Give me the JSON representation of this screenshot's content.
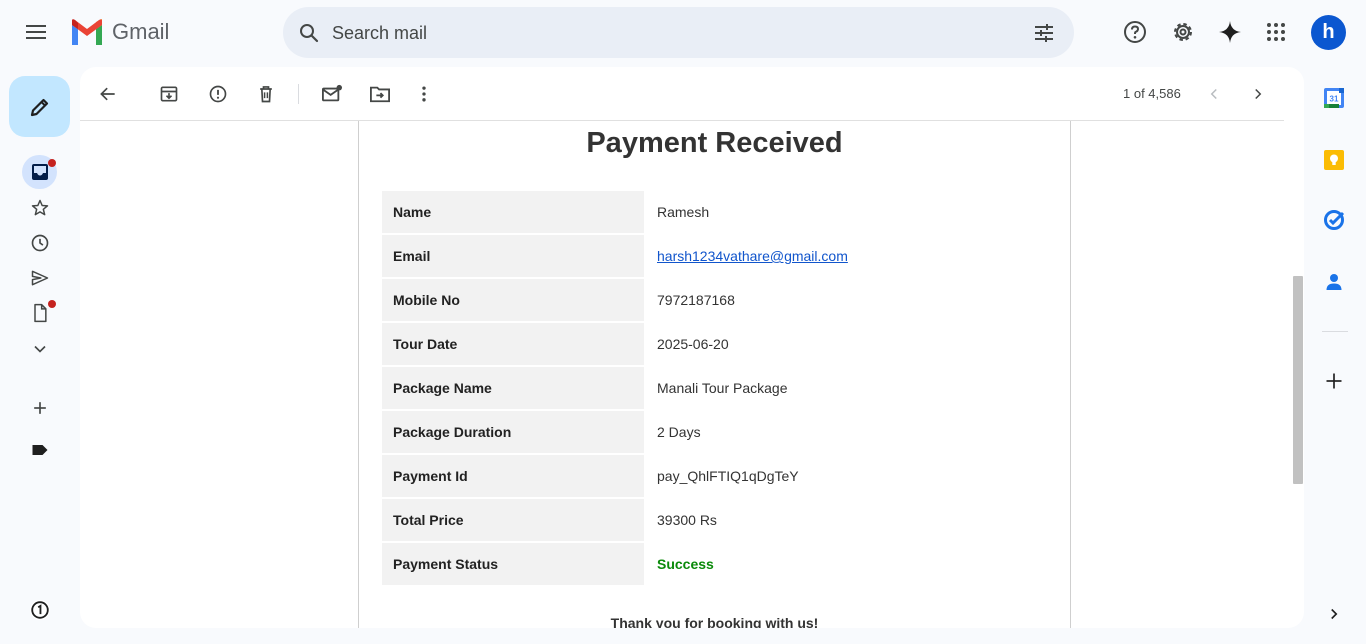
{
  "app": {
    "name": "Gmail"
  },
  "search": {
    "placeholder": "Search mail"
  },
  "profile": {
    "initial": "h"
  },
  "toolbar": {
    "page_count": "1 of 4,586"
  },
  "email": {
    "title": "Payment Received",
    "rows": [
      {
        "label": "Name",
        "value": "Ramesh"
      },
      {
        "label": "Email",
        "value": "harsh1234vathare@gmail.com"
      },
      {
        "label": "Mobile No",
        "value": "7972187168"
      },
      {
        "label": "Tour Date",
        "value": "2025-06-20"
      },
      {
        "label": "Package Name",
        "value": "Manali Tour Package"
      },
      {
        "label": "Package Duration",
        "value": "2 Days"
      },
      {
        "label": "Payment Id",
        "value": "pay_QhlFTIQ1qDgTeY"
      },
      {
        "label": "Total Price",
        "value": "39300 Rs"
      },
      {
        "label": "Payment Status",
        "value": "Success"
      }
    ],
    "footer": "Thank you for booking with us!"
  },
  "side_apps": {
    "calendar_day": "31"
  },
  "colors": {
    "accent": "#0b57d0",
    "compose_bg": "#c2e7ff",
    "success": "#0a8a0a",
    "notification": "#c5221f"
  }
}
